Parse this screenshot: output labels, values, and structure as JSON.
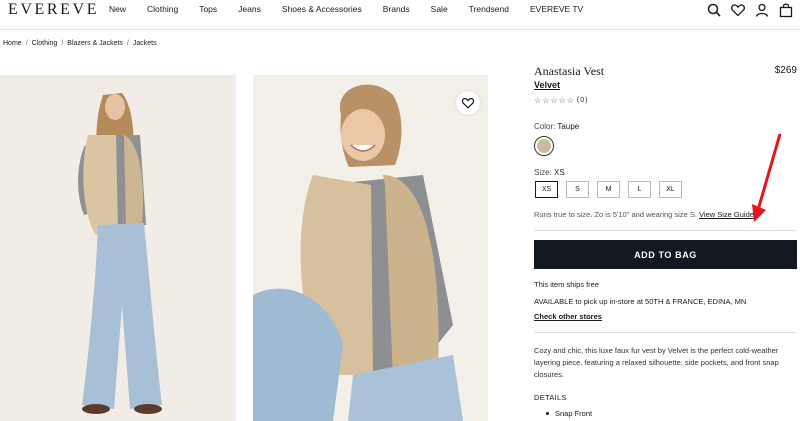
{
  "header": {
    "logo": "EVEREVE",
    "nav": [
      "New",
      "Clothing",
      "Tops",
      "Jeans",
      "Shoes & Accessories",
      "Brands",
      "Sale",
      "Trendsend",
      "EVEREVE TV"
    ],
    "icons": [
      "search-icon",
      "heart-icon",
      "account-icon",
      "bag-icon"
    ]
  },
  "breadcrumb": [
    "Home",
    "Clothing",
    "Blazers & Jackets",
    "Jackets"
  ],
  "product": {
    "title": "Anastasia Vest",
    "price": "$269",
    "brand": "Velvet",
    "stars": "☆☆☆☆☆",
    "review_count": "(0)",
    "color_label": "Color:",
    "color_value": "Taupe",
    "swatch_color": "#c8bb9f",
    "size_label": "Size:",
    "size_value": "XS",
    "sizes": [
      "XS",
      "S",
      "M",
      "L",
      "XL"
    ],
    "fit_note": "Runs true to size. Zo is 5'10\" and wearing size S.",
    "size_guide_link": "View Size Guide",
    "add_to_bag": "ADD TO BAG",
    "shipping": "This item ships free",
    "pickup": "AVAILABLE to pick up in-store at 50TH & FRANCE, EDINA, MN",
    "other_stores": "Check other stores",
    "description": "Cozy and chic, this luxe faux fur vest by Velvet is the perfect cold-weather layering piece, featuring a relaxed silhouette, side pockets, and front snap closures.",
    "details_heading": "DETAILS",
    "details": [
      "Snap Front"
    ]
  },
  "colors": {
    "accent_button": "#111820",
    "arrow": "#e8141b"
  }
}
